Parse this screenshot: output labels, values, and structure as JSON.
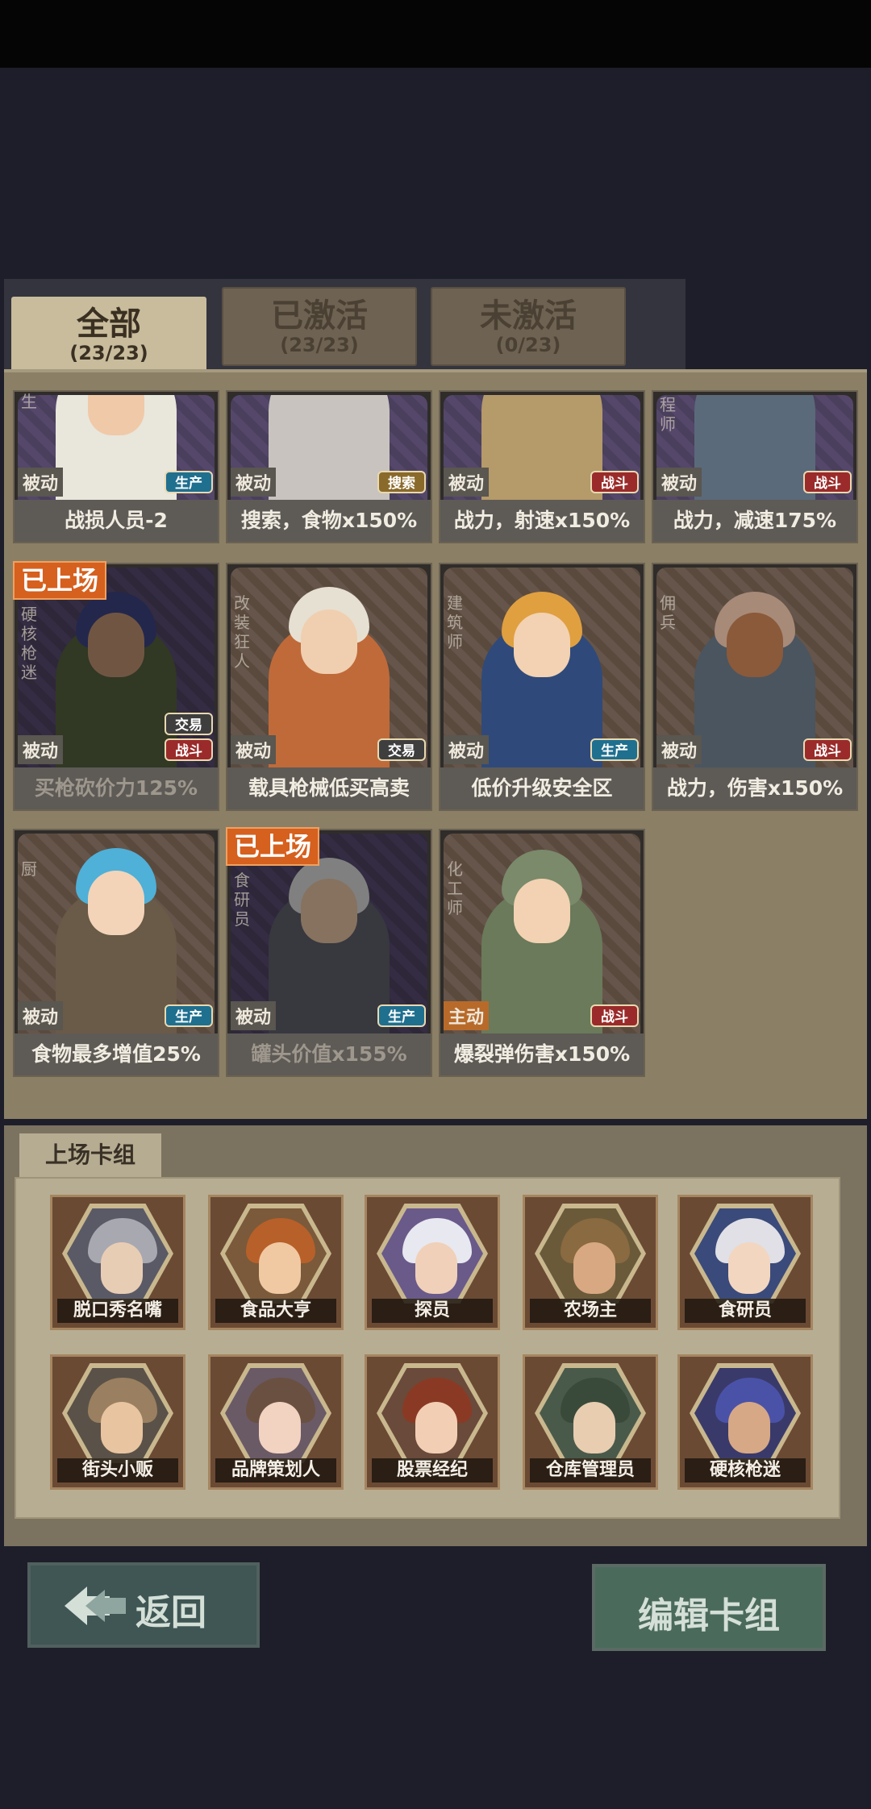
{
  "tabs": [
    {
      "label": "全部",
      "count": "(23/23)",
      "active": true
    },
    {
      "label": "已激活",
      "count": "(23/23)",
      "active": false
    },
    {
      "label": "未激活",
      "count": "(0/23)",
      "active": false
    }
  ],
  "cards": [
    {
      "role": "生",
      "type": "被动",
      "badges": [
        "生产"
      ],
      "effect": "战损人员-2",
      "on_field": false
    },
    {
      "role": "",
      "type": "被动",
      "badges": [
        "搜索"
      ],
      "effect": "搜索，食物x150%",
      "on_field": false
    },
    {
      "role": "",
      "type": "被动",
      "badges": [
        "战斗"
      ],
      "effect": "战力，射速x150%",
      "on_field": false
    },
    {
      "role": "程师",
      "type": "被动",
      "badges": [
        "战斗"
      ],
      "effect": "战力，减速175%",
      "on_field": false
    },
    {
      "role": "硬核枪迷",
      "type": "被动",
      "badges": [
        "交易",
        "战斗"
      ],
      "effect": "买枪砍价力125%",
      "on_field": true
    },
    {
      "role": "改装狂人",
      "type": "被动",
      "badges": [
        "交易"
      ],
      "effect": "载具枪械低买高卖",
      "on_field": false
    },
    {
      "role": "建筑师",
      "type": "被动",
      "badges": [
        "生产"
      ],
      "effect": "低价升级安全区",
      "on_field": false
    },
    {
      "role": "佣兵",
      "type": "被动",
      "badges": [
        "战斗"
      ],
      "effect": "战力，伤害x150%",
      "on_field": false
    },
    {
      "role": "厨",
      "type": "被动",
      "badges": [
        "生产"
      ],
      "effect": "食物最多增值25%",
      "on_field": false
    },
    {
      "role": "食研员",
      "type": "被动",
      "badges": [
        "生产"
      ],
      "effect": "罐头价值x155%",
      "on_field": true
    },
    {
      "role": "化工师",
      "type": "主动",
      "badges": [
        "战斗"
      ],
      "effect": "爆裂弹伤害x150%",
      "on_field": false
    }
  ],
  "on_field_label": "已上场",
  "deck": {
    "title": "上场卡组",
    "members": [
      "脱口秀名嘴",
      "食品大亨",
      "探员",
      "农场主",
      "食研员",
      "街头小贩",
      "品牌策划人",
      "股票经纪",
      "仓库管理员",
      "硬核枪迷"
    ]
  },
  "buttons": {
    "back": "返回",
    "edit": "编辑卡组"
  },
  "colors": {
    "production": "#1f6f8f",
    "fight": "#9a2b2a",
    "search": "#8a6a2a",
    "trade": "#3e3e3e",
    "on_field": "#d6601e"
  }
}
